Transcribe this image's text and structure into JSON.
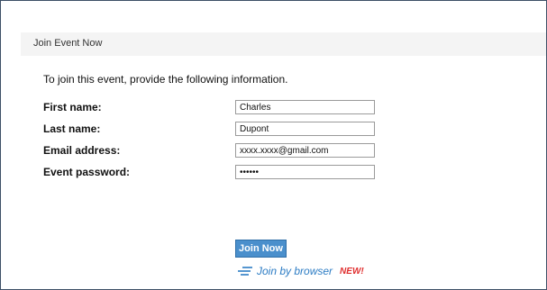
{
  "header": {
    "title": "Join Event Now"
  },
  "form": {
    "intro": "To join this event, provide the following information.",
    "fields": [
      {
        "label": "First name:",
        "value": "Charles",
        "type": "text"
      },
      {
        "label": "Last name:",
        "value": "Dupont",
        "type": "text"
      },
      {
        "label": "Email address:",
        "value": "xxxx.xxxx@gmail.com",
        "type": "text"
      },
      {
        "label": "Event password:",
        "value": "123456",
        "type": "password"
      }
    ]
  },
  "actions": {
    "join_label": "Join Now",
    "browser_label": "Join by browser",
    "new_badge": "NEW!",
    "browser_icon": "lines-icon"
  },
  "colors": {
    "button_bg": "#4a8fcc",
    "link": "#2c7cc4",
    "badge": "#e03030",
    "frame_border": "#3d4f66"
  }
}
